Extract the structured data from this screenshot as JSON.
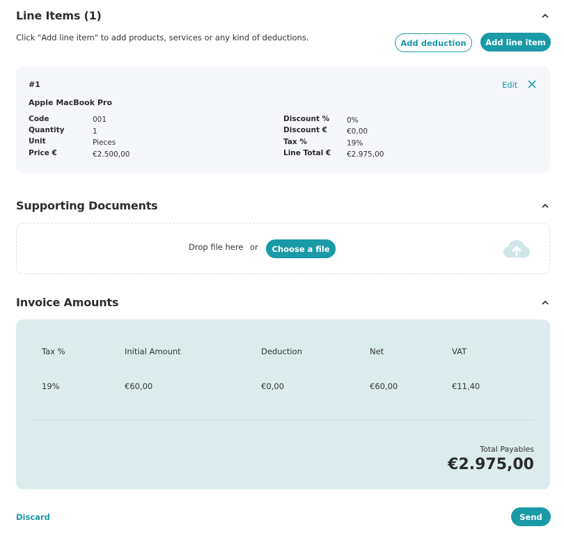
{
  "line_items": {
    "title": "Line Items (1)",
    "hint": "Click \"Add line item\" to add products, services or any kind of deductions.",
    "add_deduction_label": "Add deduction",
    "add_line_item_label": "Add line item",
    "items": [
      {
        "number": "#1",
        "name": "Apple MacBook Pro",
        "edit_label": "Edit",
        "code_label": "Code",
        "code": "001",
        "quantity_label": "Quantity",
        "quantity": "1",
        "unit_label": "Unit",
        "unit": "Pieces",
        "price_label": "Price €",
        "price": "€2.500,00",
        "discount_pct_label": "Discount %",
        "discount_pct": "0%",
        "discount_eur_label": "Discount €",
        "discount_eur": "€0,00",
        "tax_label": "Tax %",
        "tax": "19%",
        "line_total_label": "Line Total €",
        "line_total": "€2.975,00"
      }
    ]
  },
  "supporting_documents": {
    "title": "Supporting Documents",
    "drop_text": "Drop file here",
    "or_text": "or",
    "choose_label": "Choose a file",
    "icon": "cloud-upload-icon"
  },
  "invoice_amounts": {
    "title": "Invoice Amounts",
    "headers": [
      "Tax %",
      "Initial Amount",
      "Deduction",
      "Net",
      "VAT"
    ],
    "rows": [
      [
        "19%",
        "€60,00",
        "€0,00",
        "€60,00",
        "€11,40"
      ]
    ],
    "total_label": "Total Payables",
    "total_value": "€2.975,00"
  },
  "footer": {
    "discard_label": "Discard",
    "send_label": "Send"
  },
  "colors": {
    "accent": "#1a9aa6",
    "card_bg": "#f5f7fa",
    "amounts_bg": "#dcecec"
  }
}
